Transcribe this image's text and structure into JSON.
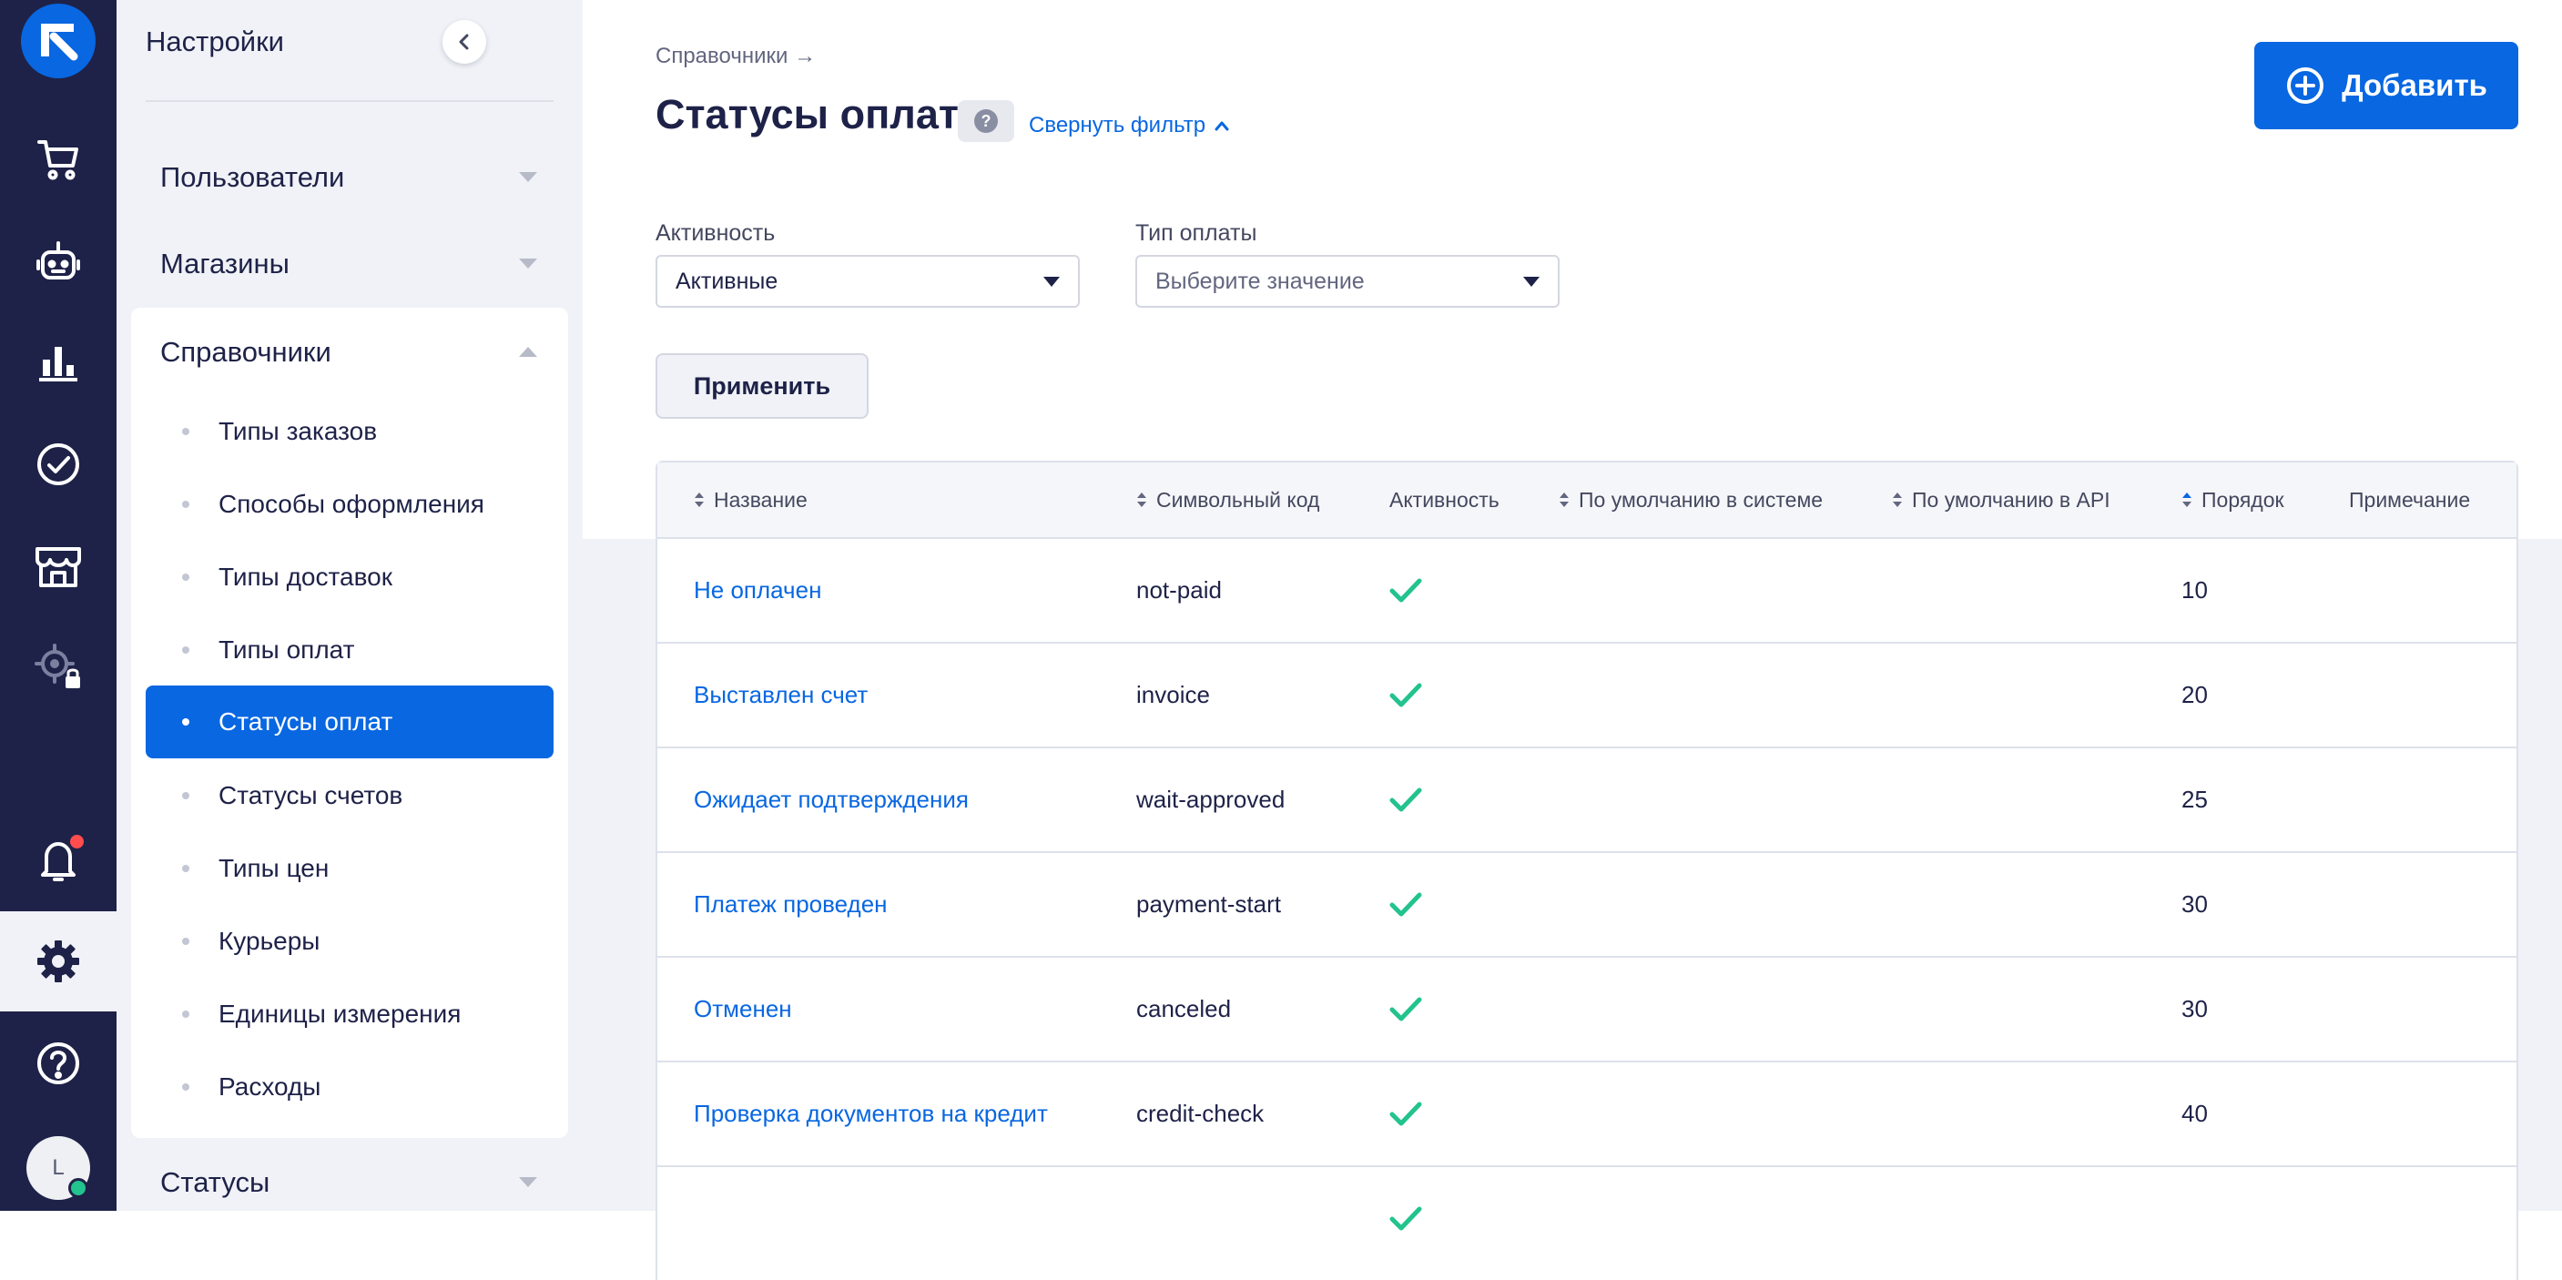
{
  "sidebar": {
    "title": "Настройки",
    "groups": {
      "users": "Пользователи",
      "shops": "Магазины",
      "directories": "Справочники",
      "statuses": "Статусы"
    },
    "items": [
      {
        "label": "Типы заказов"
      },
      {
        "label": "Способы оформления"
      },
      {
        "label": "Типы доставок"
      },
      {
        "label": "Типы оплат"
      },
      {
        "label": "Статусы оплат"
      },
      {
        "label": "Статусы счетов"
      },
      {
        "label": "Типы цен"
      },
      {
        "label": "Курьеры"
      },
      {
        "label": "Единицы измерения"
      },
      {
        "label": "Расходы"
      }
    ],
    "active_item": "Статусы оплат"
  },
  "rail": {
    "icons": [
      "logo-icon",
      "cart-icon",
      "bot-icon",
      "analytics-icon",
      "tasks-icon",
      "store-icon",
      "integrations-icon",
      "bell-icon",
      "gear-icon",
      "help-icon"
    ],
    "avatar_letter": "L",
    "colors": {
      "rail_bg": "#1e2248",
      "accent": "#0867e1",
      "notification": "#ff4d4d",
      "online": "#22c38e"
    }
  },
  "header": {
    "breadcrumb": "Справочники →",
    "title": "Статусы оплат",
    "help_label": "?",
    "collapse_filter": "Свернуть фильтр",
    "add_button": "Добавить"
  },
  "filters": {
    "activity": {
      "label": "Активность",
      "value": "Активные"
    },
    "payment_type": {
      "label": "Тип оплаты",
      "placeholder": "Выберите значение"
    },
    "apply": "Применить"
  },
  "table": {
    "columns": {
      "name": "Название",
      "code": "Символьный код",
      "active": "Активность",
      "default_system": "По умолчанию в системе",
      "default_api": "По умолчанию в API",
      "order": "Порядок",
      "note": "Примечание"
    },
    "rows": [
      {
        "name": "Не оплачен",
        "code": "not-paid",
        "active": true,
        "order": "10"
      },
      {
        "name": "Выставлен счет",
        "code": "invoice",
        "active": true,
        "order": "20"
      },
      {
        "name": "Ожидает подтверждения",
        "code": "wait-approved",
        "active": true,
        "order": "25"
      },
      {
        "name": "Платеж проведен",
        "code": "payment-start",
        "active": true,
        "order": "30"
      },
      {
        "name": "Отменен",
        "code": "canceled",
        "active": true,
        "order": "30"
      },
      {
        "name": "Проверка документов на кредит",
        "code": "credit-check",
        "active": true,
        "order": "40"
      },
      {
        "name": "",
        "code": "",
        "active": true,
        "order": ""
      }
    ],
    "check_color": "#22c38e"
  }
}
